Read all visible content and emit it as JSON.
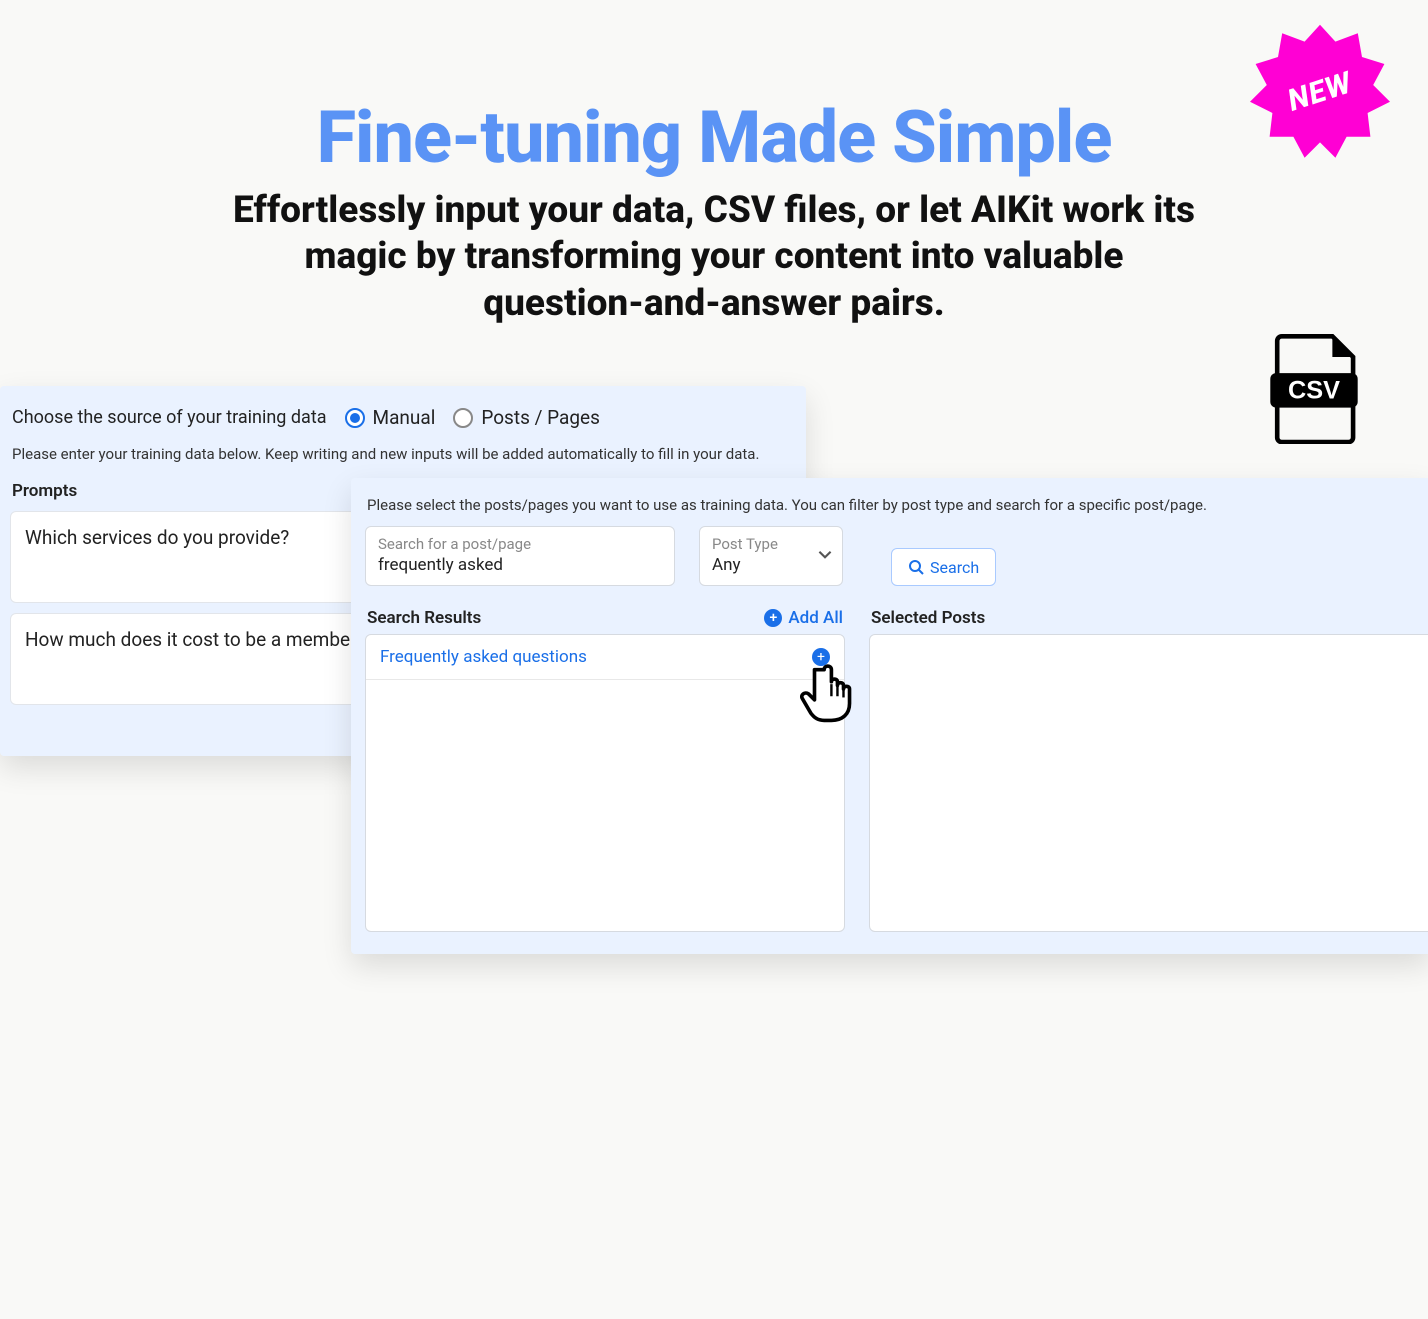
{
  "hero": {
    "title": "Fine-tuning Made Simple",
    "subtitle": "Effortlessly input your data, CSV files, or let AIKit work its magic by transforming your content into valuable question-and-answer pairs."
  },
  "badge": {
    "label": "NEW"
  },
  "manual_panel": {
    "source_label": "Choose the source of your training data",
    "options": {
      "manual": "Manual",
      "posts": "Posts / Pages"
    },
    "helper": "Please enter your training data below. Keep writing and new inputs will be added automatically to fill in your data.",
    "prompts_label": "Prompts",
    "prompts": [
      "Which services do you provide?",
      "How much does it cost to be a member?"
    ]
  },
  "posts_panel": {
    "helper": "Please select the posts/pages you want to use as training data. You can filter by post type and search for a specific post/page.",
    "search": {
      "placeholder": "Search for a post/page",
      "value": "frequently asked"
    },
    "post_type": {
      "label": "Post Type",
      "value": "Any"
    },
    "search_button": "Search",
    "results_label": "Search Results",
    "add_all": "Add All",
    "selected_label": "Selected Posts",
    "results": [
      {
        "title": "Frequently asked questions"
      }
    ]
  }
}
